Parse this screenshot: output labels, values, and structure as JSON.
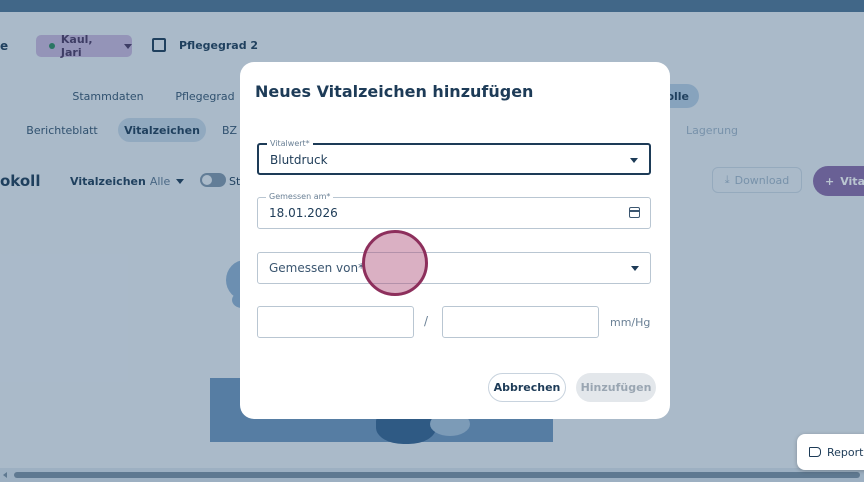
{
  "background": {
    "left_edge_text": "e",
    "patient": {
      "name": "Kaul, Jari"
    },
    "care_level": "Pflegegrad 2",
    "tabs_top": [
      "Stammdaten",
      "Pflegegrad",
      "olle"
    ],
    "tabs_sub": [
      "Berichteblatt",
      "Vitalzeichen",
      "BZ",
      "Lagerung"
    ],
    "page_title_fragment": "okoll",
    "filter": {
      "label": "Vitalzeichen",
      "value": "Alle"
    },
    "toggle_label_fragment": "St",
    "download_label": "Download",
    "add_vital_label": "Vital",
    "report_label": "Report a"
  },
  "modal": {
    "title": "Neues Vitalzeichen hinzufügen",
    "vitalwert": {
      "label": "Vitalwert*",
      "value": "Blutdruck"
    },
    "gemessen_am": {
      "label": "Gemessen am*",
      "value": "18.01.2026"
    },
    "gemessen_von": {
      "placeholder": "Gemessen von*"
    },
    "bp_separator": "/",
    "unit": "mm/Hg",
    "cancel_label": "Abbrechen",
    "add_label": "Hinzufügen"
  },
  "colors": {
    "primary": "#1d3b57",
    "accent_purple": "#8a6aa8",
    "cursor_ring": "#8d2f5c"
  }
}
